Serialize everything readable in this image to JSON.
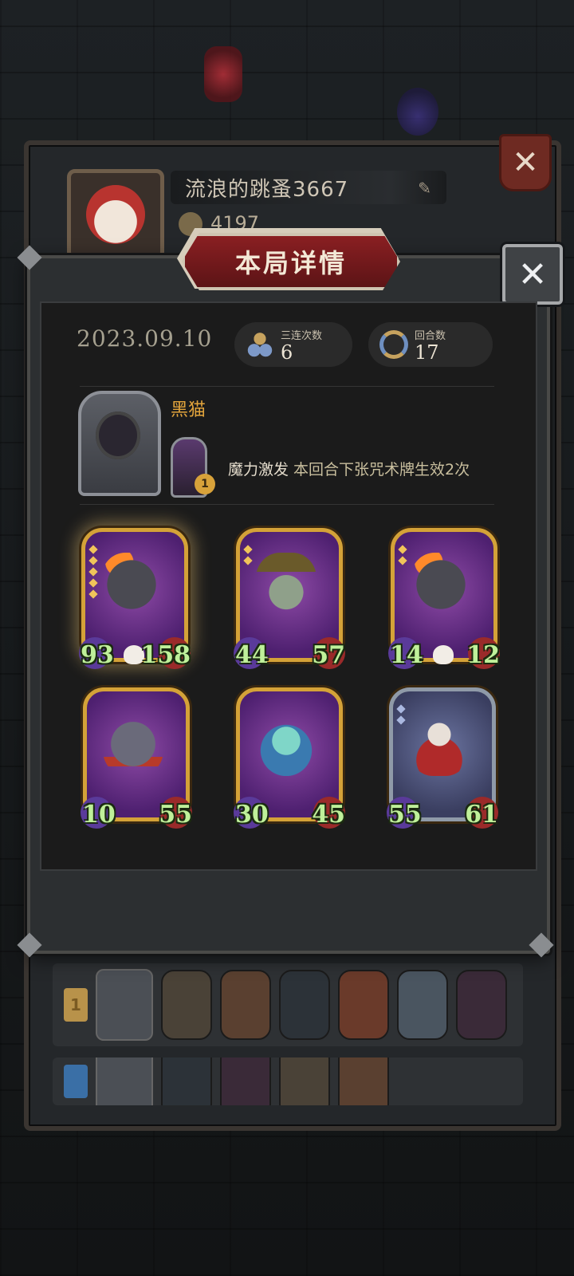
{
  "profile": {
    "name": "流浪的跳蚤3667",
    "coins": "4197",
    "close_label": "✕"
  },
  "modal": {
    "title": "本局详情",
    "close_label": "✕",
    "date": "2023.09.10",
    "stats": [
      {
        "label": "三连次数",
        "value": "6",
        "icon": "triple-icon"
      },
      {
        "label": "回合数",
        "value": "17",
        "icon": "round-arrows-icon"
      }
    ],
    "hero": {
      "name": "黑猫",
      "skill_name": "魔力激发",
      "skill_desc": "本回合下张咒术牌生效2次",
      "skill_level": "1"
    },
    "units": [
      {
        "atk": "93",
        "hp": "158",
        "art": "bull",
        "golden": true,
        "skull": true
      },
      {
        "atk": "44",
        "hp": "57",
        "art": "witch",
        "golden": true,
        "skull": false
      },
      {
        "atk": "14",
        "hp": "12",
        "art": "bull",
        "golden": true,
        "skull": true
      },
      {
        "atk": "10",
        "hp": "55",
        "art": "rat",
        "golden": true,
        "skull": false
      },
      {
        "atk": "30",
        "hp": "45",
        "art": "elf",
        "golden": true,
        "skull": false
      },
      {
        "atk": "55",
        "hp": "61",
        "art": "clown",
        "golden": false,
        "skull": false
      }
    ]
  },
  "history": {
    "rows": [
      {
        "rank": "1"
      },
      {
        "rank": ""
      }
    ]
  }
}
